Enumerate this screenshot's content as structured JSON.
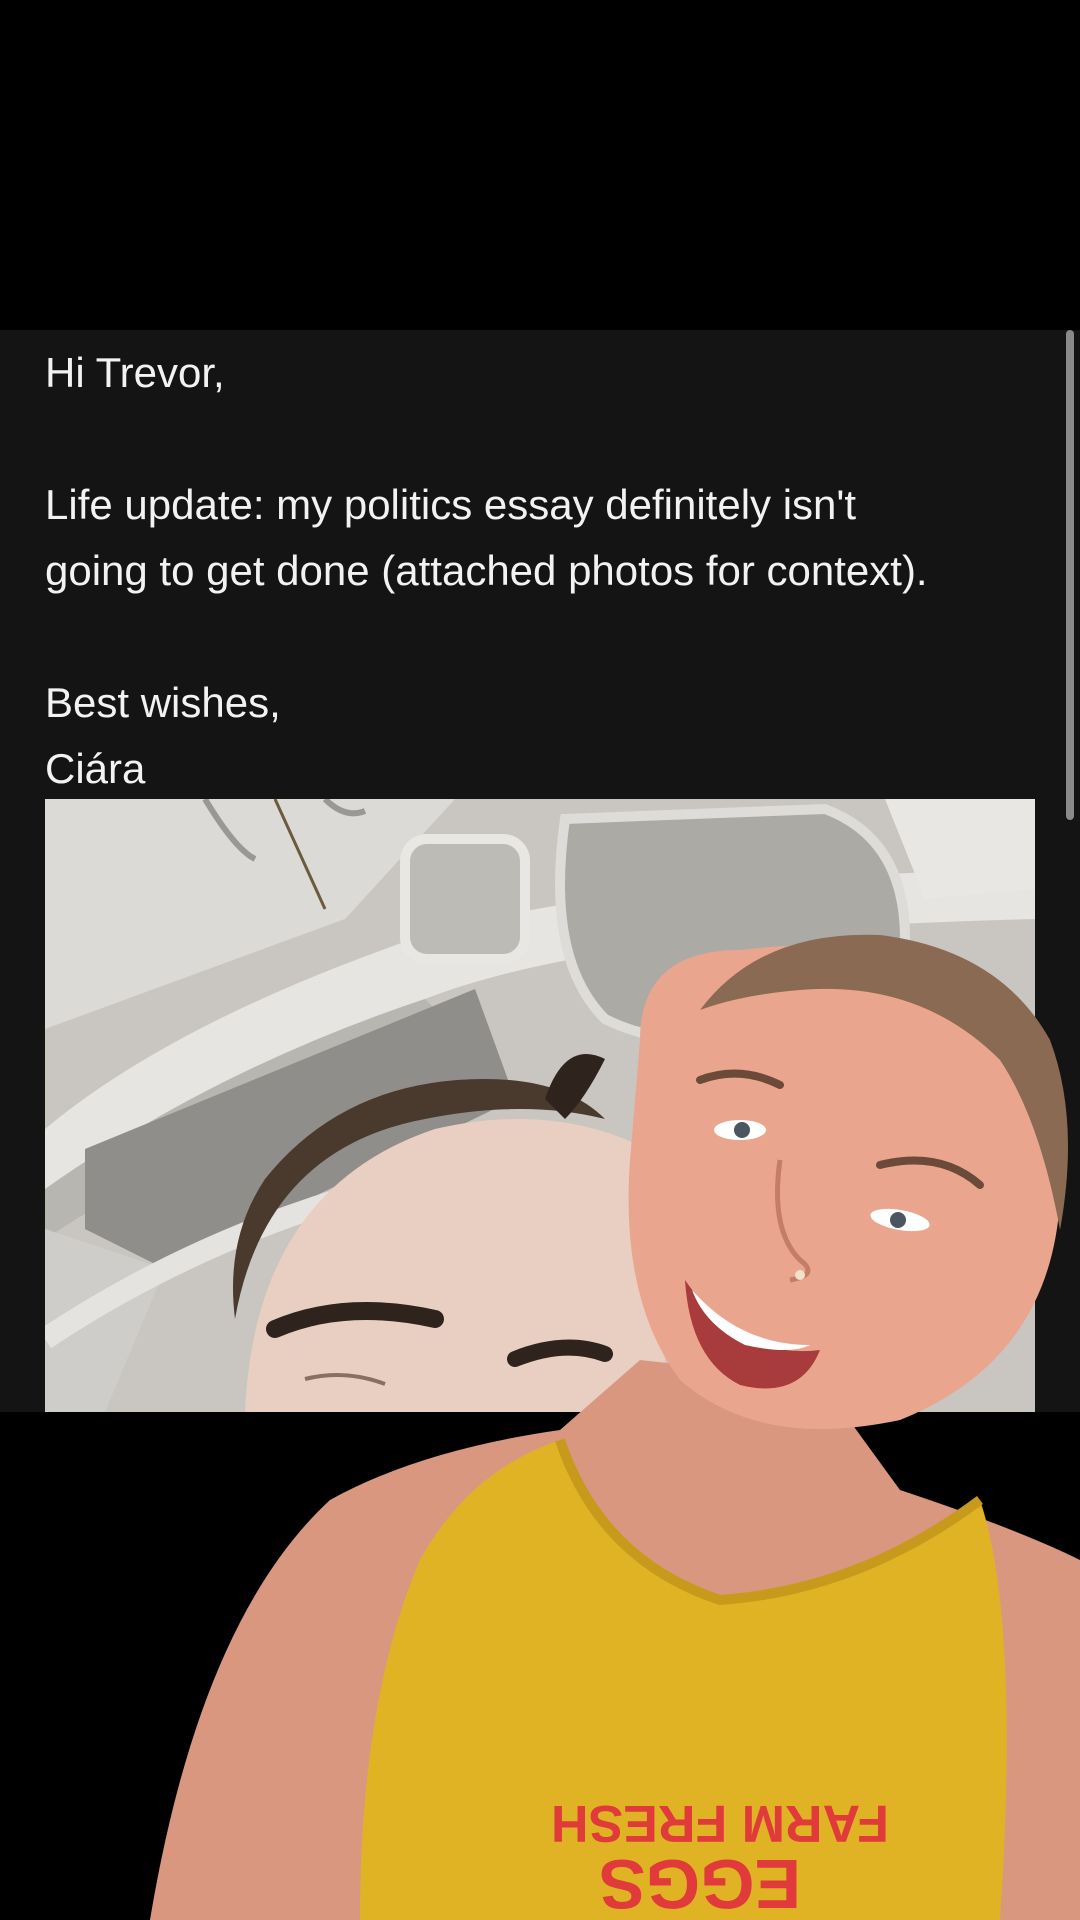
{
  "email": {
    "greeting": "Hi Trevor,",
    "body_line_1": "Life update: my politics essay definitely isn't",
    "body_line_2": "going to get done (attached photos for context).",
    "signoff": "Best wishes,",
    "signature": "Ciára"
  },
  "attachment": {
    "icon": "photo-attachment"
  },
  "overlay": {
    "shirt_text_line_1": "FARM FRESH",
    "shirt_text_line_2": "EGGS"
  },
  "colors": {
    "panel_background": "#141414",
    "text": "#f2f2f2",
    "shirt": "#e0b325",
    "shirt_print": "#e03a3a"
  }
}
